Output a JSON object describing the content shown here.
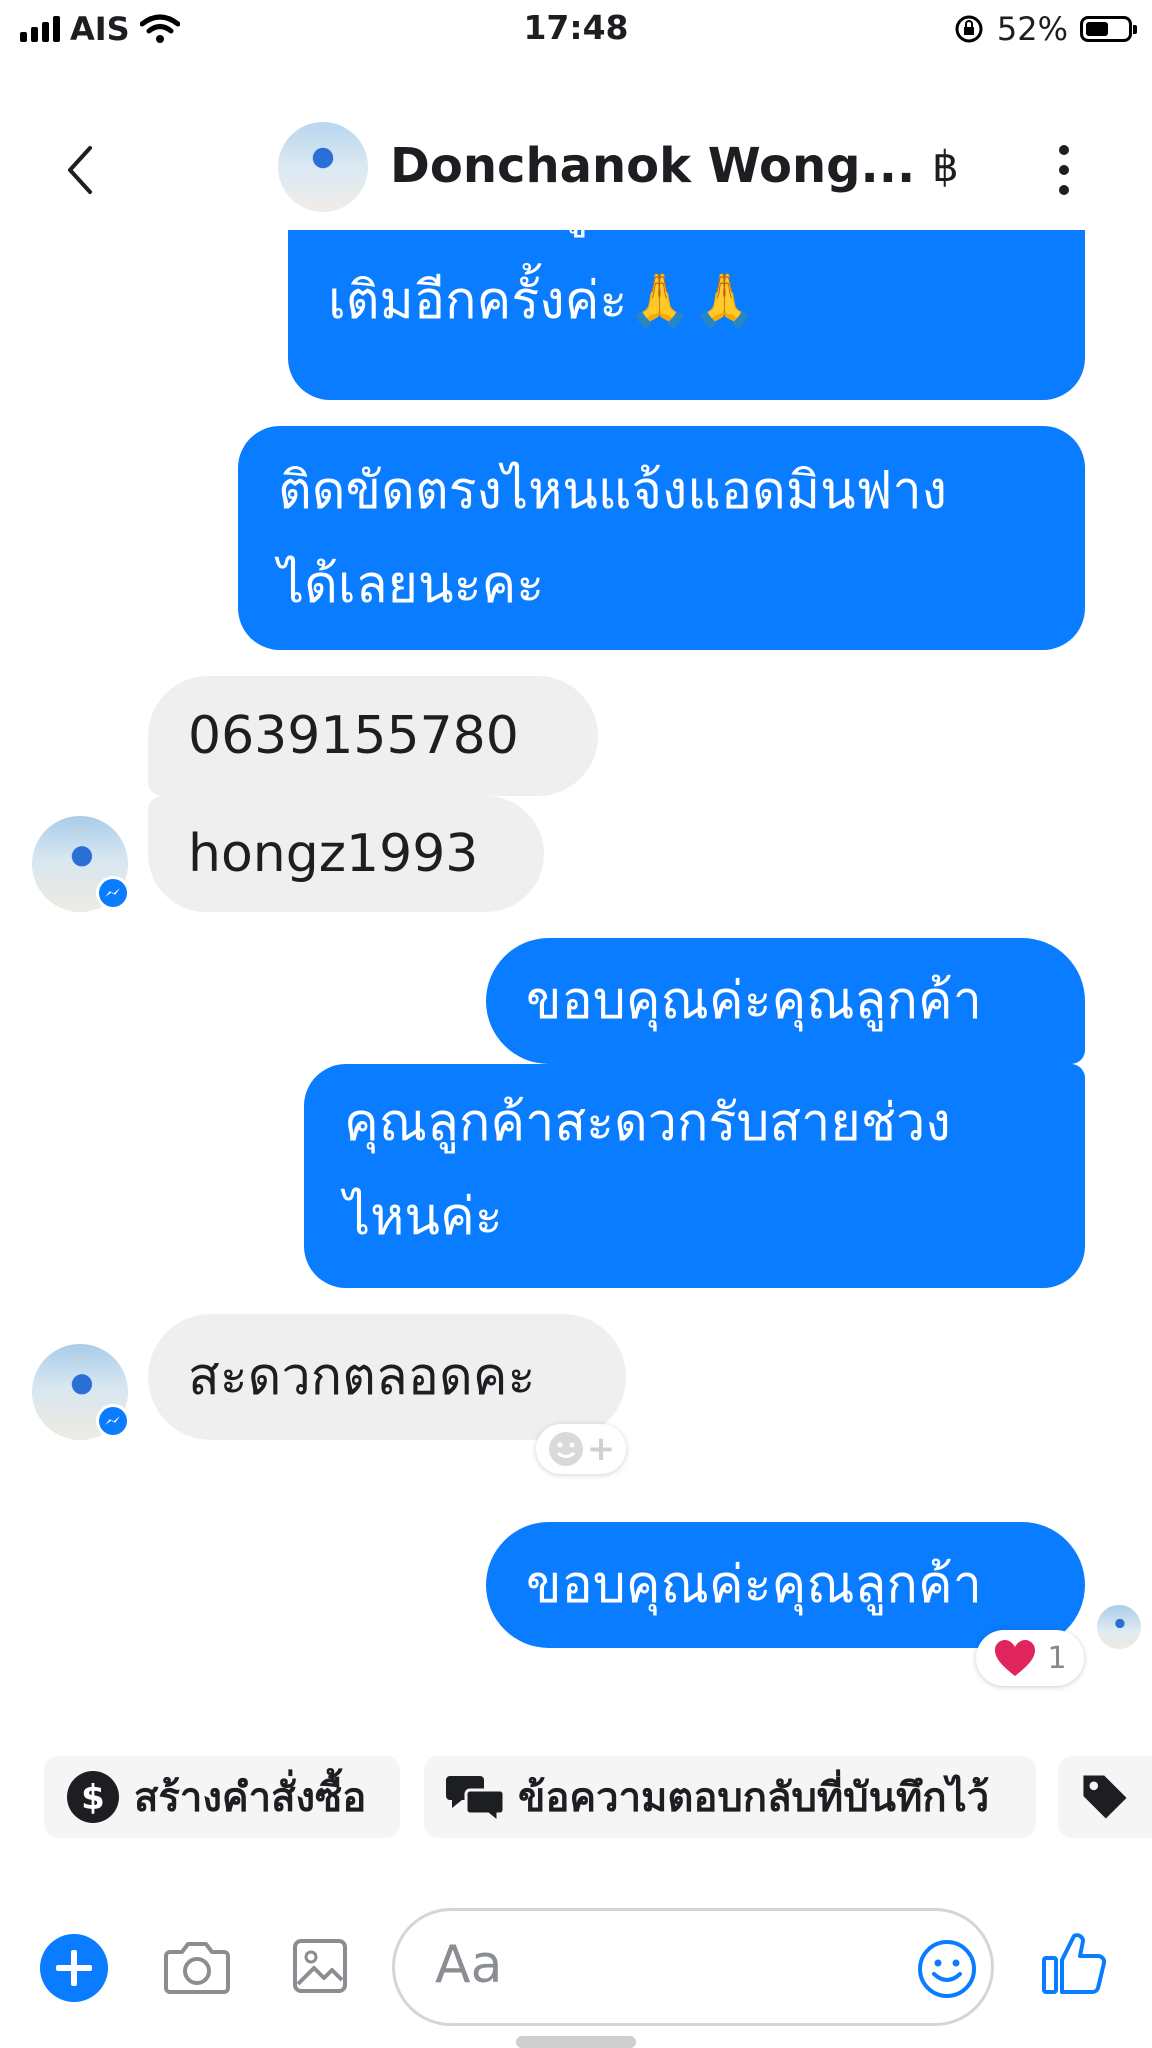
{
  "status_bar": {
    "carrier": "AIS",
    "time": "17:48",
    "battery": "52%"
  },
  "header": {
    "contact_name": "Donchanok Wong...",
    "currency_symbol": "฿"
  },
  "messages": [
    {
      "side": "out",
      "lines": [
        "เพื่อ ให้ข้อมูลและอธิบายเพิ่ม",
        "เติมอีกครั้งค่ะ🙏🙏"
      ]
    },
    {
      "side": "out",
      "lines": [
        "ติดขัดตรงไหนแจ้งแอดมินฟาง",
        "ได้เลยนะคะ"
      ]
    },
    {
      "side": "in",
      "lines": [
        "0639155780"
      ]
    },
    {
      "side": "in",
      "lines": [
        "hongz1993"
      ]
    },
    {
      "side": "out",
      "lines": [
        "ขอบคุณค่ะคุณลูกค้า"
      ]
    },
    {
      "side": "out",
      "lines": [
        "คุณลูกค้าสะดวกรับสายช่วง",
        "ไหนค่ะ"
      ]
    },
    {
      "side": "in",
      "lines": [
        "สะดวกตลอดคะ"
      ]
    },
    {
      "side": "out",
      "lines": [
        "ขอบคุณค่ะคุณลูกค้า"
      ]
    }
  ],
  "reaction": {
    "emoji": "❤️",
    "count": "1"
  },
  "quick_replies": [
    {
      "label": "สร้างคำสั่งซื้อ",
      "icon": "dollar-circle-icon"
    },
    {
      "label": "ข้อความตอบกลับที่บันทึกไว้",
      "icon": "chat-bubbles-icon"
    },
    {
      "label": "",
      "icon": "tag-icon"
    }
  ],
  "composer": {
    "placeholder": "Aa"
  },
  "colors": {
    "accent": "#0a7cff",
    "incoming_bubble": "#efefef",
    "reaction_heart": "#e0245e"
  }
}
